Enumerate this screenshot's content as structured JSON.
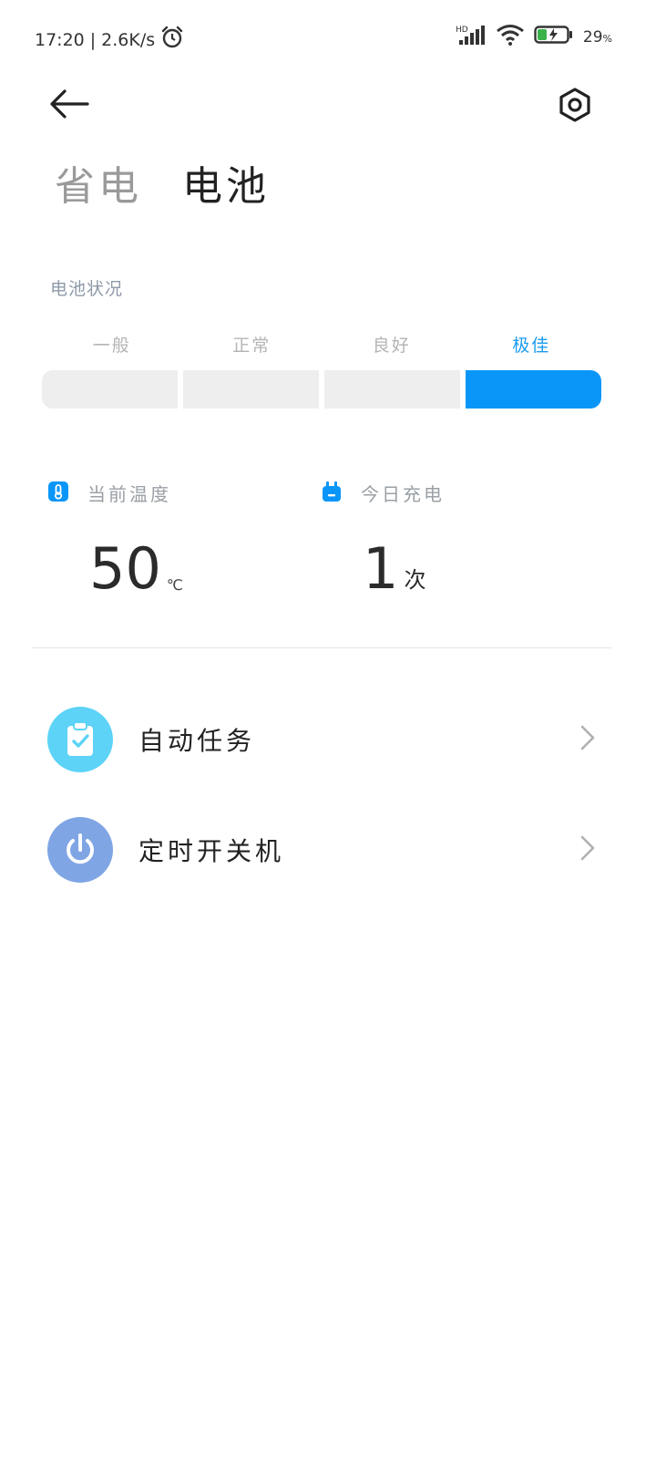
{
  "status_bar": {
    "time": "17:20",
    "speed": "2.6K/s",
    "battery_percent": "29",
    "battery_unit": "%",
    "network_tag": "HD"
  },
  "header": {
    "tabs": [
      {
        "label": "省电",
        "active": false
      },
      {
        "label": "电池",
        "active": true
      }
    ]
  },
  "battery_condition": {
    "title": "电池状况",
    "levels": [
      {
        "label": "一般",
        "active": false
      },
      {
        "label": "正常",
        "active": false
      },
      {
        "label": "良好",
        "active": false
      },
      {
        "label": "极佳",
        "active": true
      }
    ]
  },
  "stats": {
    "temperature": {
      "label": "当前温度",
      "value": "50",
      "unit": "℃",
      "icon": "thermometer-icon"
    },
    "charge_count": {
      "label": "今日充电",
      "value": "1",
      "unit": "次",
      "icon": "plug-icon"
    }
  },
  "menu": [
    {
      "label": "自动任务",
      "icon": "clipboard-check-icon",
      "color": "#5cd3f7"
    },
    {
      "label": "定时开关机",
      "icon": "power-icon",
      "color": "#7fa5e4"
    }
  ],
  "colors": {
    "accent": "#0a96f8",
    "accent_text": "#1b9bf0"
  }
}
